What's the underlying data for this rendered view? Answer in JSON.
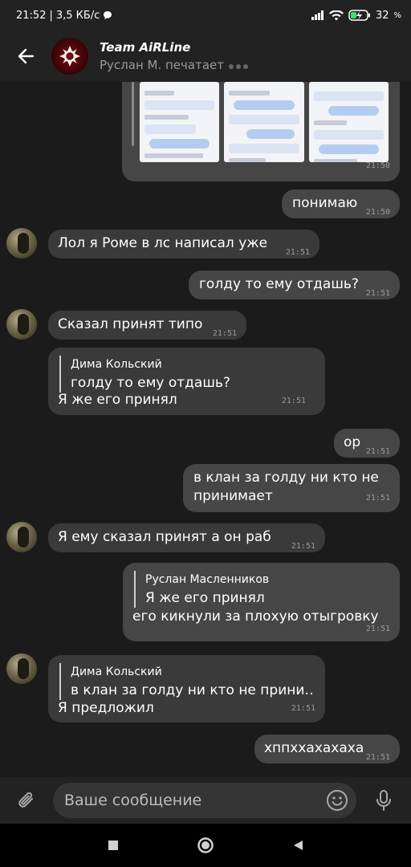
{
  "status_bar": {
    "time": "21:52",
    "speed": "3,5 КБ/с",
    "battery": "32"
  },
  "header": {
    "title": "Team AiRLine",
    "subtitle": "Руслан М. печатает"
  },
  "messages": [
    {
      "id": "m1",
      "side": "out",
      "type": "media",
      "time": "21:50"
    },
    {
      "id": "m2",
      "side": "out",
      "text": "понимаю",
      "time": "21:50"
    },
    {
      "id": "m3",
      "side": "in",
      "text": "Лол я Роме в лс написал уже",
      "time": "21:51"
    },
    {
      "id": "m4",
      "side": "out",
      "text": "голду то ему отдашь?",
      "time": "21:51"
    },
    {
      "id": "m5",
      "side": "in",
      "text": "Сказал принят типо",
      "time": "21:51"
    },
    {
      "id": "m6",
      "side": "in",
      "quote_author": "Дима Кольский",
      "quote_text": "голду то ему отдашь?",
      "text": "Я же его принял",
      "time": "21:51"
    },
    {
      "id": "m7",
      "side": "out",
      "text": "ор",
      "time": "21:51"
    },
    {
      "id": "m8",
      "side": "out",
      "text_line1": "в клан за голду ни кто не",
      "text_line2": "принимает",
      "time": "21:51"
    },
    {
      "id": "m9",
      "side": "in",
      "text": "Я ему сказал принят а он раб",
      "time": "21:51"
    },
    {
      "id": "m10",
      "side": "out",
      "quote_author": "Руслан Масленников",
      "quote_text": "Я же его принял",
      "text": "его кикнули за плохую отыгровку",
      "time": "21:51"
    },
    {
      "id": "m11",
      "side": "in",
      "quote_author": "Дима Кольский",
      "quote_text": "в клан за голду ни кто не прини…",
      "text": "Я предложил",
      "time": "21:51"
    },
    {
      "id": "m12",
      "side": "out",
      "text": "хппххахахаха",
      "time": "21:51"
    }
  ],
  "composer": {
    "placeholder": "Ваше сообщение"
  },
  "icons": [
    "back-arrow-icon",
    "attach-icon",
    "emoji-icon",
    "mic-icon",
    "nav-square-icon",
    "nav-circle-icon",
    "nav-triangle-icon",
    "signal-icon",
    "wifi-icon",
    "battery-icon"
  ],
  "colors": {
    "background": "#1b1b1b",
    "bar": "#222222",
    "incoming_bubble": "#3a3a3a",
    "outgoing_bubble": "#464646"
  }
}
